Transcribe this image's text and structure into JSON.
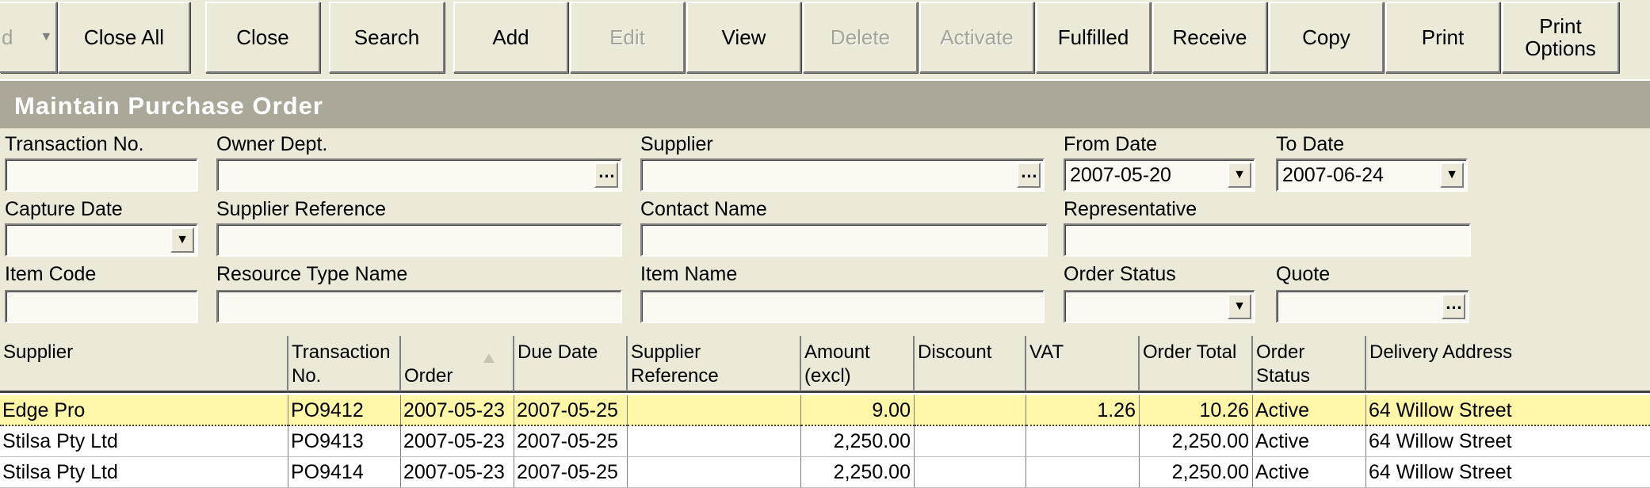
{
  "toolbar": {
    "stub_label": "d",
    "buttons": [
      {
        "label": "Close All",
        "enabled": true
      },
      {
        "label": "Close",
        "enabled": true
      },
      {
        "label": "Search",
        "enabled": true
      },
      {
        "label": "Add",
        "enabled": true
      },
      {
        "label": "Edit",
        "enabled": false
      },
      {
        "label": "View",
        "enabled": true
      },
      {
        "label": "Delete",
        "enabled": false
      },
      {
        "label": "Activate",
        "enabled": false
      },
      {
        "label": "Fulfilled",
        "enabled": true
      },
      {
        "label": "Receive",
        "enabled": true
      },
      {
        "label": "Copy",
        "enabled": true
      },
      {
        "label": "Print",
        "enabled": true
      },
      {
        "label": "Print\nOptions",
        "enabled": true
      }
    ]
  },
  "title": "Maintain Purchase Order",
  "filters": {
    "transaction_no": {
      "label": "Transaction No.",
      "value": ""
    },
    "owner_dept": {
      "label": "Owner Dept.",
      "value": ""
    },
    "supplier": {
      "label": "Supplier",
      "value": ""
    },
    "from_date": {
      "label": "From Date",
      "value": "2007-05-20"
    },
    "to_date": {
      "label": "To Date",
      "value": "2007-06-24"
    },
    "capture_date": {
      "label": "Capture Date",
      "value": "  -  -"
    },
    "supplier_reference": {
      "label": "Supplier Reference",
      "value": ""
    },
    "contact_name": {
      "label": "Contact Name",
      "value": ""
    },
    "representative": {
      "label": "Representative",
      "value": ""
    },
    "item_code": {
      "label": "Item Code",
      "value": ""
    },
    "resource_type_name": {
      "label": "Resource Type Name",
      "value": ""
    },
    "item_name": {
      "label": "Item Name",
      "value": ""
    },
    "order_status": {
      "label": "Order Status",
      "value": ""
    },
    "quote": {
      "label": "Quote",
      "value": ""
    }
  },
  "grid": {
    "columns": [
      "Supplier",
      "Transaction\nNo.",
      "Order\nDate",
      "Due Date",
      "Supplier\nReference",
      "Amount\n(excl)",
      "Discount",
      "VAT",
      "Order Total",
      "Order\nStatus",
      "Delivery Address"
    ],
    "rows": [
      [
        "Edge Pro",
        "PO9412",
        "2007-05-23",
        "2007-05-25",
        "",
        "9.00",
        "",
        "1.26",
        "10.26",
        "Active",
        "64 Willow Street"
      ],
      [
        "Stilsa Pty Ltd",
        "PO9413",
        "2007-05-23",
        "2007-05-25",
        "",
        "2,250.00",
        "",
        "",
        "2,250.00",
        "Active",
        "64 Willow Street"
      ],
      [
        "Stilsa Pty Ltd",
        "PO9414",
        "2007-05-23",
        "2007-05-25",
        "",
        "2,250.00",
        "",
        "",
        "2,250.00",
        "Active",
        "64 Willow Street"
      ]
    ],
    "selected_row": 0
  },
  "colors": {
    "face": "#ece9d8",
    "title_band": "#aca899",
    "selected_row": "#fff6a8"
  }
}
